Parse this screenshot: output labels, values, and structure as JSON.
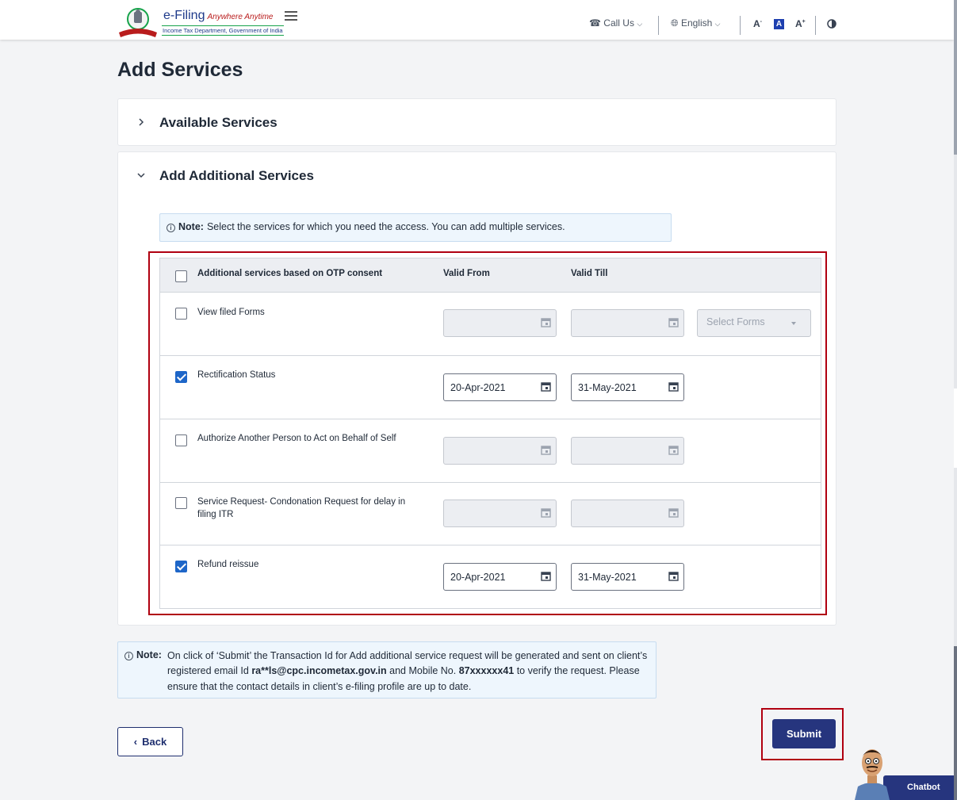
{
  "header": {
    "logo_title": "e-Filing",
    "logo_tagline": "Anywhere Anytime",
    "logo_subtitle": "Income Tax Department, Government of India",
    "call_us": "Call Us",
    "language": "English",
    "font_decrease": "A",
    "font_default": "A",
    "font_increase": "A"
  },
  "page_title": "Add Services",
  "available_services": {
    "label": "Available Services"
  },
  "additional_services": {
    "label": "Add Additional Services",
    "note_label": "Note:",
    "note_text": "Select the services for which you need the access. You can add multiple services.",
    "table": {
      "col_service": "Additional services based on OTP consent",
      "col_valid_from": "Valid From",
      "col_valid_till": "Valid Till",
      "rows": [
        {
          "service": "View filed Forms",
          "checked": false,
          "valid_from": "",
          "valid_till": "",
          "select_placeholder": "Select Forms"
        },
        {
          "service": "Rectification Status",
          "checked": true,
          "valid_from": "20-Apr-2021",
          "valid_till": "31-May-2021"
        },
        {
          "service": "Authorize Another Person to Act on Behalf of Self",
          "checked": false,
          "valid_from": "",
          "valid_till": ""
        },
        {
          "service": "Service Request- Condonation Request for delay in filing ITR",
          "checked": false,
          "valid_from": "",
          "valid_till": ""
        },
        {
          "service": "Refund reissue",
          "checked": true,
          "valid_from": "20-Apr-2021",
          "valid_till": "31-May-2021"
        }
      ]
    }
  },
  "bottom_note": {
    "label": "Note:",
    "text_1": "On click of ‘Submit’ the Transaction Id for Add additional service request will be generated and sent on client’s registered email Id ",
    "email": "ra**ls@cpc.incometax.gov.in",
    "text_2": " and Mobile No. ",
    "mobile": "87xxxxxx41",
    "text_3": " to verify the request. Please ensure that the contact details in client’s e-filing profile are up to date."
  },
  "buttons": {
    "back": "Back",
    "submit": "Submit"
  },
  "chatbot": {
    "label": "Chatbot"
  },
  "colors": {
    "primary": "#26357e",
    "highlight": "#b00010",
    "checkbox": "#1e66c8",
    "note_bg": "#eef6fd"
  }
}
